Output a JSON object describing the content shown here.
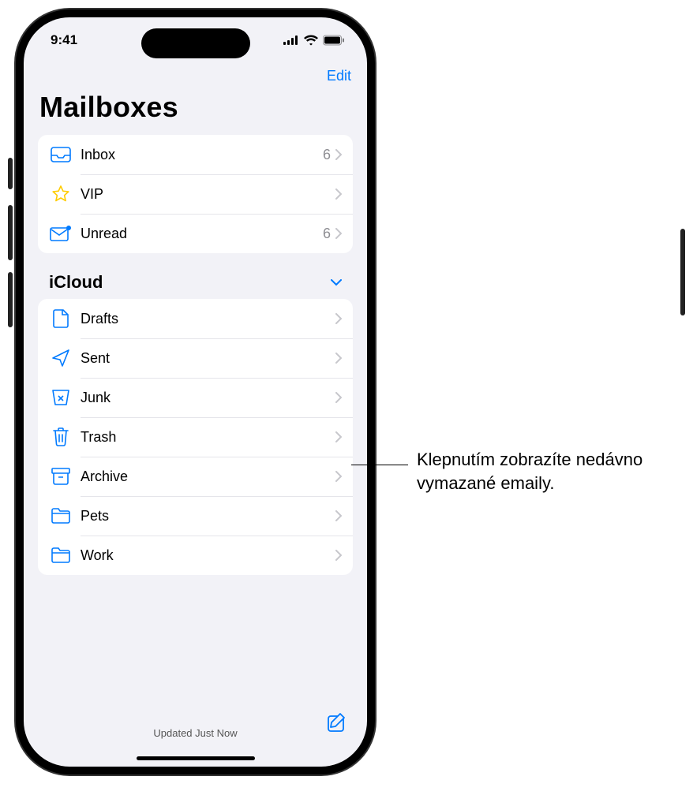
{
  "status": {
    "time": "9:41"
  },
  "nav": {
    "edit": "Edit"
  },
  "title": "Mailboxes",
  "top_boxes": [
    {
      "icon": "inbox-icon",
      "label": "Inbox",
      "count": "6"
    },
    {
      "icon": "star-icon",
      "label": "VIP",
      "count": ""
    },
    {
      "icon": "unread-icon",
      "label": "Unread",
      "count": "6"
    }
  ],
  "section": {
    "title": "iCloud"
  },
  "icloud_boxes": [
    {
      "icon": "drafts-icon",
      "label": "Drafts"
    },
    {
      "icon": "sent-icon",
      "label": "Sent"
    },
    {
      "icon": "junk-icon",
      "label": "Junk"
    },
    {
      "icon": "trash-icon",
      "label": "Trash"
    },
    {
      "icon": "archive-icon",
      "label": "Archive"
    },
    {
      "icon": "folder-icon",
      "label": "Pets"
    },
    {
      "icon": "folder-icon",
      "label": "Work"
    }
  ],
  "toolbar": {
    "status": "Updated Just Now"
  },
  "callout": {
    "text": "Klepnutím zobrazíte nedávno vymazané emaily."
  },
  "colors": {
    "accent": "#007aff",
    "icon_yellow": "#ffcc00"
  }
}
